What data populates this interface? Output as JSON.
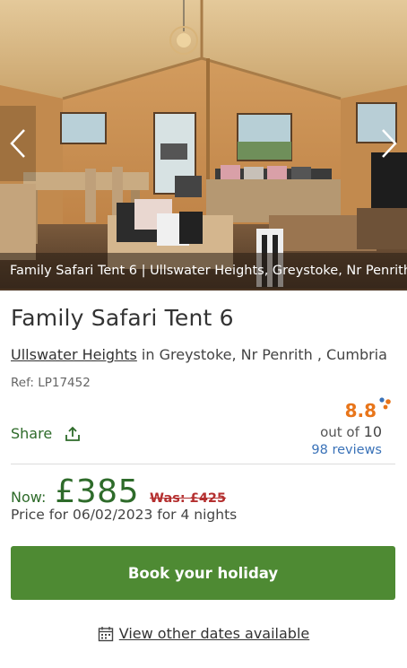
{
  "hero": {
    "caption": "Family Safari Tent 6 | Ullswater Heights, Greystoke, Nr Penrith",
    "image_subject": "safari tent interior"
  },
  "listing": {
    "title": "Family Safari Tent 6",
    "site_link": "Ullswater Heights",
    "location_rest": " in Greystoke, Nr Penrith , Cumbria",
    "ref": "Ref: LP17452"
  },
  "share": {
    "label": "Share",
    "icon": "share-upload-icon"
  },
  "rating": {
    "score": "8.8",
    "out_of_prefix": "out of ",
    "out_of_value": "10",
    "reviews": "98 reviews"
  },
  "pricing": {
    "now_label": "Now:",
    "price": "£385",
    "was": "Was: £425",
    "note": "Price for 06/02/2023 for 4 nights"
  },
  "cta": {
    "book_label": "Book your holiday"
  },
  "dates": {
    "label": "View other dates available",
    "icon": "calendar-icon"
  },
  "colors": {
    "primary_green": "#4e8a33",
    "text_green": "#2e6b2a",
    "rating_orange": "#e8751a",
    "link_blue": "#3a72b8",
    "was_red": "#b42f2f"
  }
}
